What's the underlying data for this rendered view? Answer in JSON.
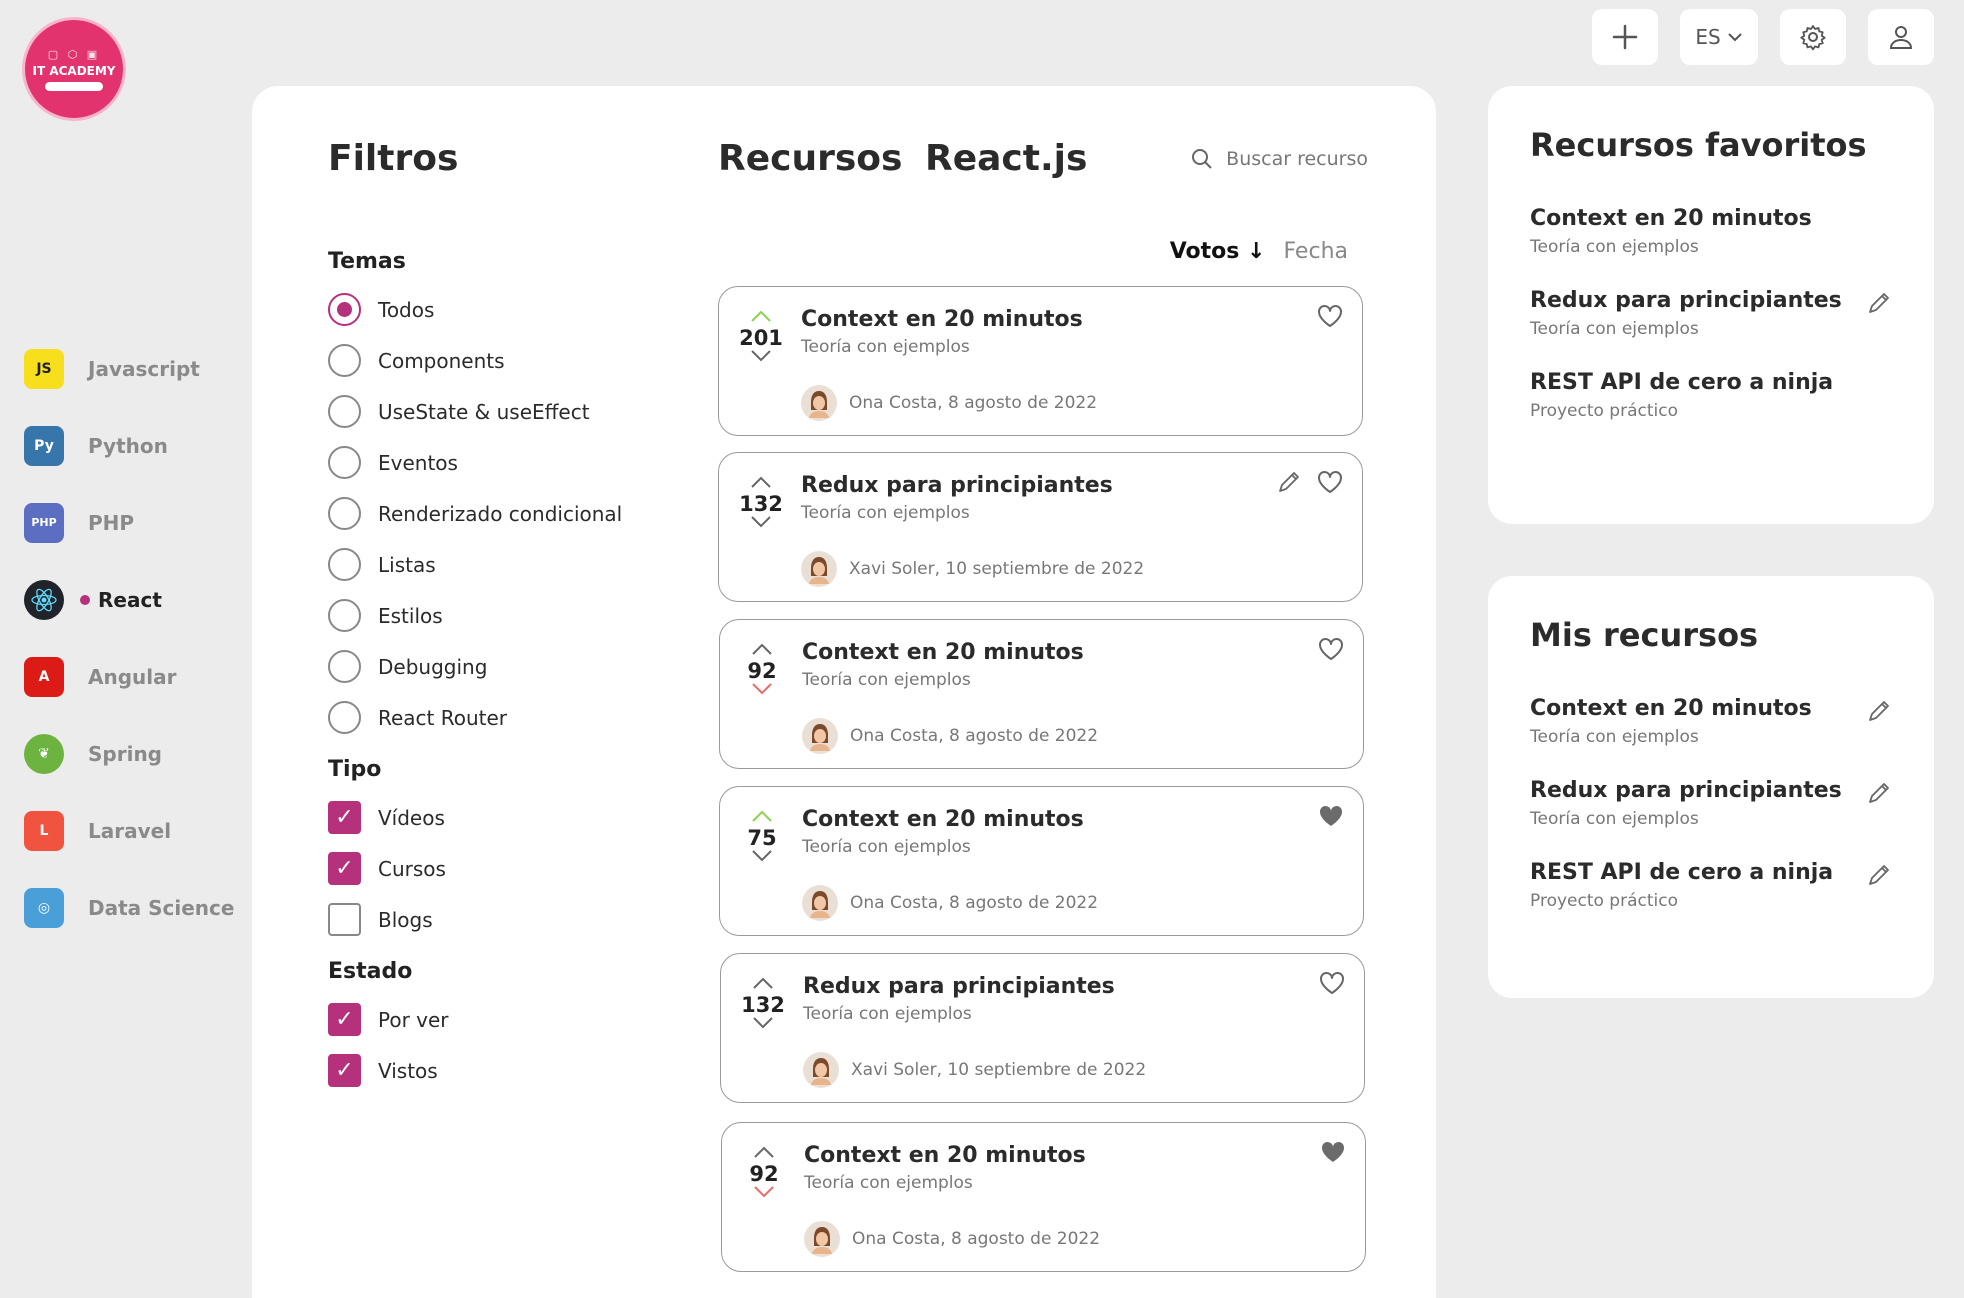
{
  "brand": {
    "name": "IT ACADEMY"
  },
  "topbar": {
    "add_icon": "plus-icon",
    "language": "ES",
    "settings_icon": "gear-icon",
    "user_icon": "user-icon"
  },
  "sidebar": {
    "items": [
      {
        "label": "Javascript",
        "icon": "js",
        "color": "#f7df1e"
      },
      {
        "label": "Python",
        "icon": "py",
        "color": "#3776ab"
      },
      {
        "label": "PHP",
        "icon": "php",
        "color": "#5b6ec2"
      },
      {
        "label": "React",
        "icon": "react",
        "color": "#20232a",
        "active": true
      },
      {
        "label": "Angular",
        "icon": "ng",
        "color": "#dd1b16"
      },
      {
        "label": "Spring",
        "icon": "spring",
        "color": "#6db33f"
      },
      {
        "label": "Laravel",
        "icon": "laravel",
        "color": "#f05340"
      },
      {
        "label": "Data Science",
        "icon": "ds",
        "color": "#4a9fd8"
      }
    ]
  },
  "filters": {
    "title": "Filtros",
    "temas": {
      "title": "Temas",
      "options": [
        "Todos",
        "Components",
        "UseState & useEffect",
        "Eventos",
        "Renderizado condicional",
        "Listas",
        "Estilos",
        "Debugging",
        "React Router"
      ],
      "selected": "Todos"
    },
    "tipo": {
      "title": "Tipo",
      "options": [
        {
          "label": "Vídeos",
          "checked": true
        },
        {
          "label": "Cursos",
          "checked": true
        },
        {
          "label": "Blogs",
          "checked": false
        }
      ]
    },
    "estado": {
      "title": "Estado",
      "options": [
        {
          "label": "Por ver",
          "checked": true
        },
        {
          "label": "Vistos",
          "checked": true
        }
      ]
    }
  },
  "resources": {
    "title": "Recursos React.js",
    "search_placeholder": "Buscar recurso",
    "sort": {
      "votes": "Votos",
      "date": "Fecha"
    },
    "cards": [
      {
        "votes": "201",
        "vote_state": "up",
        "title": "Context en 20 minutos",
        "subtitle": "Teoría con ejemplos",
        "author": "Ona Costa, 8 agosto de 2022",
        "editable": false,
        "favorite": false
      },
      {
        "votes": "132",
        "vote_state": "none",
        "title": "Redux para principiantes",
        "subtitle": "Teoría con ejemplos",
        "author": "Xavi Soler, 10 septiembre de 2022",
        "editable": true,
        "favorite": false
      },
      {
        "votes": "92",
        "vote_state": "down",
        "title": "Context en 20 minutos",
        "subtitle": "Teoría con ejemplos",
        "author": "Ona Costa, 8 agosto de 2022",
        "editable": false,
        "favorite": false
      },
      {
        "votes": "75",
        "vote_state": "up",
        "title": "Context en 20 minutos",
        "subtitle": "Teoría con ejemplos",
        "author": "Ona Costa, 8 agosto de 2022",
        "editable": false,
        "favorite": true
      },
      {
        "votes": "132",
        "vote_state": "none",
        "title": "Redux para principiantes",
        "subtitle": "Teoría con ejemplos",
        "author": "Xavi Soler, 10 septiembre de 2022",
        "editable": false,
        "favorite": false
      },
      {
        "votes": "92",
        "vote_state": "down",
        "title": "Context en 20 minutos",
        "subtitle": "Teoría con ejemplos",
        "author": "Ona Costa, 8 agosto de 2022",
        "editable": false,
        "favorite": true
      }
    ]
  },
  "favorites": {
    "title": "Recursos favoritos",
    "items": [
      {
        "title": "Context en 20 minutos",
        "subtitle": "Teoría con ejemplos",
        "editable": false
      },
      {
        "title": "Redux para principiantes",
        "subtitle": "Teoría con ejemplos",
        "editable": true
      },
      {
        "title": "REST API de cero a ninja",
        "subtitle": "Proyecto práctico",
        "editable": false
      }
    ]
  },
  "my_resources": {
    "title": "Mis recursos",
    "items": [
      {
        "title": "Context en 20 minutos",
        "subtitle": "Teoría con ejemplos",
        "editable": true
      },
      {
        "title": "Redux para principiantes",
        "subtitle": "Teoría con ejemplos",
        "editable": true
      },
      {
        "title": "REST API de cero a ninja",
        "subtitle": "Proyecto práctico",
        "editable": true
      }
    ]
  },
  "colors": {
    "accent": "#b6317c",
    "brand": "#e2336f",
    "upvote": "#8fd14f",
    "downvote": "#e86b6b"
  }
}
